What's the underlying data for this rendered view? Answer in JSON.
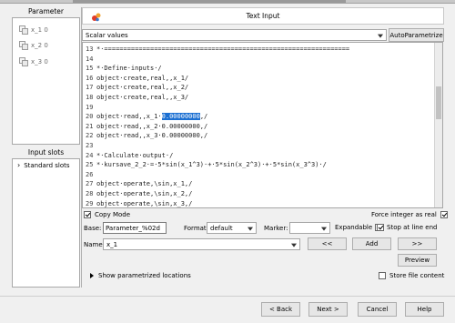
{
  "window": {
    "dialog_title": "Text Input"
  },
  "left": {
    "parameter_title": "Parameter",
    "parameters": [
      "x_1  0",
      "x_2  0",
      "x_3  0"
    ],
    "input_slots_title": "Input slots",
    "slots": [
      "Standard slots"
    ]
  },
  "main": {
    "scalar_select": "Scalar values",
    "autoparam_label": "AutoParametrize",
    "editor_lines": [
      {
        "n": "13",
        "text": "*·================================================================"
      },
      {
        "n": "14",
        "text": ""
      },
      {
        "n": "15",
        "text": "*·Define·inputs·/"
      },
      {
        "n": "16",
        "text": "object·create,real,,x_1/"
      },
      {
        "n": "17",
        "text": "object·create,real,,x_2/"
      },
      {
        "n": "18",
        "text": "object·create,real,,x_3/"
      },
      {
        "n": "19",
        "text": ""
      },
      {
        "n": "20",
        "pre": "object·read,,x_1·",
        "hl": "0.00000000",
        "post": ",/"
      },
      {
        "n": "21",
        "text": "object·read,,x_2·0.00000000,/"
      },
      {
        "n": "22",
        "text": "object·read,,x_3·0.00000000,/"
      },
      {
        "n": "23",
        "text": ""
      },
      {
        "n": "24",
        "text": "*·Calculate·output·/"
      },
      {
        "n": "25",
        "text": "*·kursave_2_2·=·5*sin(x_1^3)·+·5*sin(x_2^3)·+·5*sin(x_3^3)·/"
      },
      {
        "n": "26",
        "text": ""
      },
      {
        "n": "27",
        "text": "object·operate,\\sin,x_1,/"
      },
      {
        "n": "28",
        "text": "object·operate,\\sin,x_2,/"
      },
      {
        "n": "29",
        "text": "object·operate,\\sin,x_3,/"
      }
    ],
    "copy_mode_label": "Copy Mode",
    "copy_mode_checked": true,
    "force_integer_label": "Force integer as real",
    "force_integer_checked": true,
    "base_label": "Base:",
    "base_value": "Parameter_%02d",
    "format_label": "Format:",
    "format_value": "default",
    "marker_label": "Marker:",
    "marker_value": "",
    "expandable_label": "Expandable",
    "expandable_checked": true,
    "stop_line_end_label": "Stop at line end",
    "stop_line_end_checked": true,
    "name_label": "Name:",
    "name_value": "x_1",
    "prev_btn": "<<",
    "add_btn": "Add",
    "next_btn": ">>",
    "preview_btn": "Preview",
    "show_locations_label": "Show parametrized locations",
    "store_file_label": "Store file content",
    "store_file_checked": false
  },
  "footer": {
    "back": "< Back",
    "next": "Next >",
    "cancel": "Cancel",
    "help": "Help"
  }
}
